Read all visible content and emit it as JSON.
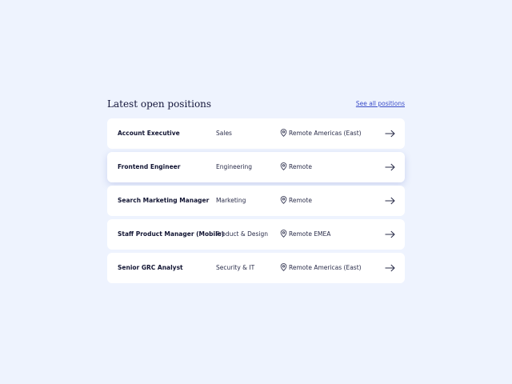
{
  "section": {
    "title": "Latest open positions",
    "see_all_label": "See all positions"
  },
  "positions": [
    {
      "title": "Account Executive",
      "department": "Sales",
      "location": "Remote Americas (East)"
    },
    {
      "title": "Frontend Engineer",
      "department": "Engineering",
      "location": "Remote"
    },
    {
      "title": "Search Marketing Manager",
      "department": "Marketing",
      "location": "Remote"
    },
    {
      "title": "Staff Product Manager (Mobile)",
      "department": "Product & Design",
      "location": "Remote EMEA"
    },
    {
      "title": "Senior GRC Analyst",
      "department": "Security & IT",
      "location": "Remote Americas (East)"
    }
  ],
  "icons": {
    "location": "map-pin-icon",
    "row_action": "arrow-right-icon"
  },
  "colors": {
    "background": "#eef3fe",
    "card": "#ffffff",
    "link": "#3a4cc8",
    "text": "#14163a"
  }
}
